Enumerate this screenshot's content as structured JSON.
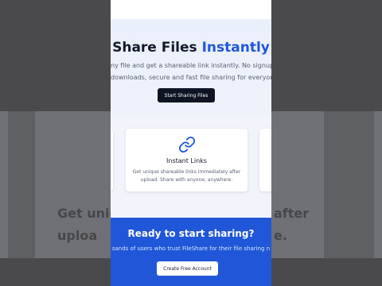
{
  "hero": {
    "title_main": "Share Files",
    "title_accent": "Instantly",
    "subtitle_line1": "ny file and get a shareable link instantly. No signup requi",
    "subtitle_line2": "downloads, secure and fast file sharing for everyone.",
    "button_label": "Start Sharing Files"
  },
  "feature_card": {
    "icon": "link-icon",
    "title": "Instant Links",
    "description": "Get unique shareable links immediately after upload. Share with anyone, anywhere."
  },
  "cta": {
    "title": "Ready to start sharing?",
    "subtitle": "sands of users who trust FileShare for their file sharing n",
    "button_label": "Create Free Account"
  },
  "backdrop": {
    "left_text": "Get uniq\nuploa",
    "right_text": "after\ne."
  },
  "colors": {
    "accent": "#1f57d8",
    "dark_button": "#0f1424",
    "hero_bg": "#eaf0fb"
  }
}
